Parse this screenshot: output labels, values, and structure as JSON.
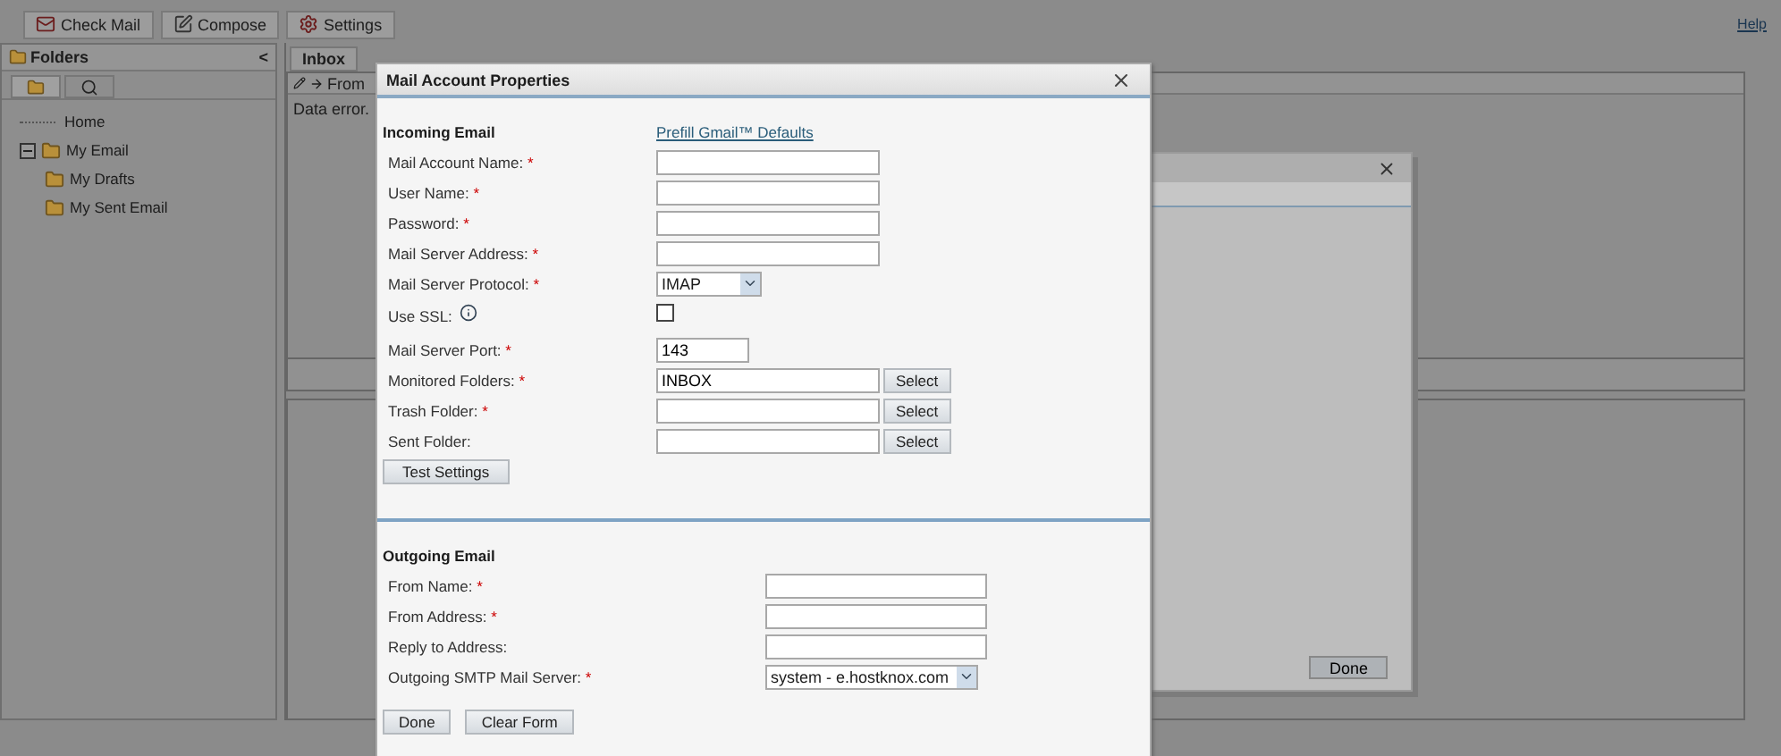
{
  "toolbar": {
    "buttons": [
      {
        "kind": "check",
        "label": "Check Mail"
      },
      {
        "kind": "compose",
        "label": "Compose"
      },
      {
        "kind": "settings",
        "label": "Settings"
      }
    ],
    "help_link": "Help"
  },
  "folders_panel": {
    "title": "Folders",
    "collapse": "<",
    "tabs": [
      {
        "kind": "folders",
        "selected": true
      },
      {
        "kind": "search",
        "selected": false
      }
    ],
    "tree": [
      {
        "label": "Home",
        "kind": "link"
      },
      {
        "label": "My Email",
        "kind": "folder",
        "expanded": true,
        "children": [
          {
            "label": "My Drafts",
            "kind": "folder"
          },
          {
            "label": "My Sent Email",
            "kind": "folder"
          }
        ]
      }
    ]
  },
  "inbox": {
    "tab": "Inbox",
    "column": "From",
    "message": "Data error."
  },
  "back_dialog": {
    "button": "Done"
  },
  "dialog": {
    "title": "Mail Account Properties",
    "incoming": {
      "heading": "Incoming Email",
      "prefill_link": "Prefill Gmail™ Defaults",
      "fields": [
        {
          "kind": "text",
          "label": "Mail Account Name:",
          "marker": "*"
        },
        {
          "kind": "text",
          "label": "User Name:",
          "marker": "*"
        },
        {
          "kind": "text",
          "label": "Password:",
          "marker": "*"
        },
        {
          "kind": "text",
          "label": "Mail Server Address:",
          "marker": "*"
        },
        {
          "kind": "select",
          "label": "Mail Server Protocol:",
          "marker": "*",
          "value": "IMAP"
        },
        {
          "kind": "checkbox",
          "label": "Use SSL:",
          "checked": false,
          "info": true
        },
        {
          "kind": "number",
          "label": "Mail Server Port:",
          "marker": "*",
          "value": "143"
        },
        {
          "kind": "text",
          "label": "Monitored Folders:",
          "marker": "*",
          "value": "INBOX",
          "button": "Select"
        },
        {
          "kind": "text",
          "label": "Trash Folder:",
          "marker": "*",
          "button": "Select"
        },
        {
          "kind": "text",
          "label": "Sent Folder:",
          "button": "Select"
        }
      ],
      "test_button": "Test Settings"
    },
    "outgoing": {
      "heading": "Outgoing Email",
      "fields": [
        {
          "kind": "text",
          "label": "From Name:",
          "marker": "*"
        },
        {
          "kind": "text",
          "label": "From Address:",
          "marker": "*"
        },
        {
          "kind": "text",
          "label": "Reply to Address:"
        },
        {
          "kind": "select",
          "label": "Outgoing SMTP Mail Server:",
          "marker": "*",
          "value": "system - e.hostknox.com"
        }
      ]
    },
    "buttons": [
      "Done",
      "Clear Form"
    ]
  }
}
